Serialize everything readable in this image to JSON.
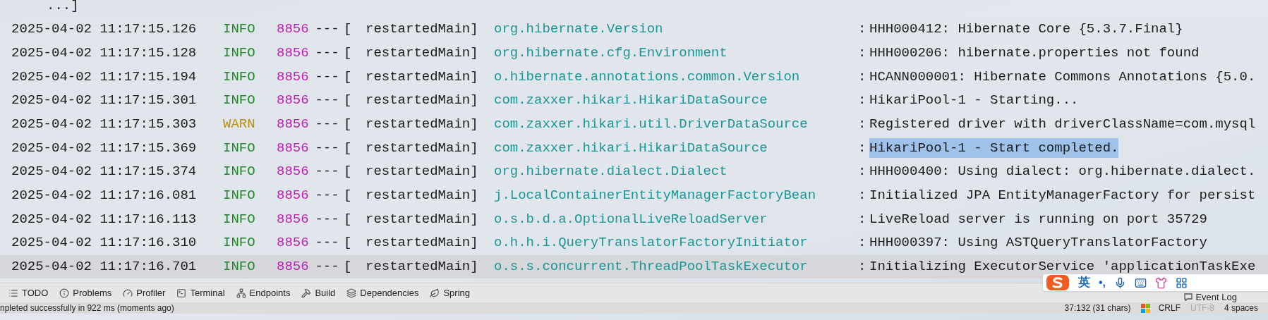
{
  "console": {
    "top_fragment": "...]",
    "rows": [
      {
        "timestamp": "2025-04-02 11:17:15.126",
        "level": "INFO",
        "kind": "info",
        "pid": "8856",
        "separator": "---",
        "bracket": "[",
        "thread": "restartedMain]",
        "logger": "org.hibernate.Version",
        "colon": ":",
        "message": "HHH000412: Hibernate Core {5.3.7.Final}",
        "message_selected": false,
        "current": false
      },
      {
        "timestamp": "2025-04-02 11:17:15.128",
        "level": "INFO",
        "kind": "info",
        "pid": "8856",
        "separator": "---",
        "bracket": "[",
        "thread": "restartedMain]",
        "logger": "org.hibernate.cfg.Environment",
        "colon": ":",
        "message": "HHH000206: hibernate.properties not found",
        "message_selected": false,
        "current": false
      },
      {
        "timestamp": "2025-04-02 11:17:15.194",
        "level": "INFO",
        "kind": "info",
        "pid": "8856",
        "separator": "---",
        "bracket": "[",
        "thread": "restartedMain]",
        "logger": "o.hibernate.annotations.common.Version",
        "colon": ":",
        "message": "HCANN000001: Hibernate Commons Annotations {5.0.",
        "message_selected": false,
        "current": false
      },
      {
        "timestamp": "2025-04-02 11:17:15.301",
        "level": "INFO",
        "kind": "info",
        "pid": "8856",
        "separator": "---",
        "bracket": "[",
        "thread": "restartedMain]",
        "logger": "com.zaxxer.hikari.HikariDataSource",
        "colon": ":",
        "message": "HikariPool-1 - Starting...",
        "message_selected": false,
        "current": false
      },
      {
        "timestamp": "2025-04-02 11:17:15.303",
        "level": "WARN",
        "kind": "warn",
        "pid": "8856",
        "separator": "---",
        "bracket": "[",
        "thread": "restartedMain]",
        "logger": "com.zaxxer.hikari.util.DriverDataSource",
        "colon": ":",
        "message": "Registered driver with driverClassName=com.mysql",
        "message_selected": false,
        "current": false
      },
      {
        "timestamp": "2025-04-02 11:17:15.369",
        "level": "INFO",
        "kind": "info",
        "pid": "8856",
        "separator": "---",
        "bracket": "[",
        "thread": "restartedMain]",
        "logger": "com.zaxxer.hikari.HikariDataSource",
        "colon": ":",
        "message": "HikariPool-1 - Start completed.",
        "message_selected": true,
        "current": false
      },
      {
        "timestamp": "2025-04-02 11:17:15.374",
        "level": "INFO",
        "kind": "info",
        "pid": "8856",
        "separator": "---",
        "bracket": "[",
        "thread": "restartedMain]",
        "logger": "org.hibernate.dialect.Dialect",
        "colon": ":",
        "message": "HHH000400: Using dialect: org.hibernate.dialect.",
        "message_selected": false,
        "current": false
      },
      {
        "timestamp": "2025-04-02 11:17:16.081",
        "level": "INFO",
        "kind": "info",
        "pid": "8856",
        "separator": "---",
        "bracket": "[",
        "thread": "restartedMain]",
        "logger": "j.LocalContainerEntityManagerFactoryBean",
        "colon": ":",
        "message": "Initialized JPA EntityManagerFactory for persist",
        "message_selected": false,
        "current": false
      },
      {
        "timestamp": "2025-04-02 11:17:16.113",
        "level": "INFO",
        "kind": "info",
        "pid": "8856",
        "separator": "---",
        "bracket": "[",
        "thread": "restartedMain]",
        "logger": "o.s.b.d.a.OptionalLiveReloadServer",
        "colon": ":",
        "message": "LiveReload server is running on port 35729",
        "message_selected": false,
        "current": false
      },
      {
        "timestamp": "2025-04-02 11:17:16.310",
        "level": "INFO",
        "kind": "info",
        "pid": "8856",
        "separator": "---",
        "bracket": "[",
        "thread": "restartedMain]",
        "logger": "o.h.h.i.QueryTranslatorFactoryInitiator",
        "colon": ":",
        "message": "HHH000397: Using ASTQueryTranslatorFactory",
        "message_selected": false,
        "current": false
      },
      {
        "timestamp": "2025-04-02 11:17:16.701",
        "level": "INFO",
        "kind": "info",
        "pid": "8856",
        "separator": "---",
        "bracket": "[",
        "thread": "restartedMain]",
        "logger": "o.s.s.concurrent.ThreadPoolTaskExecutor",
        "colon": ":",
        "message": "Initializing ExecutorService 'applicationTaskExe",
        "message_selected": false,
        "current": true
      }
    ]
  },
  "tool_window_bar": {
    "items": [
      {
        "label": "TODO"
      },
      {
        "label": "Problems"
      },
      {
        "label": "Profiler"
      },
      {
        "label": "Terminal"
      },
      {
        "label": "Endpoints"
      },
      {
        "label": "Build"
      },
      {
        "label": "Dependencies"
      },
      {
        "label": "Spring"
      }
    ],
    "event_log": "Event Log"
  },
  "status_bar": {
    "message": "npleted successfully in 922 ms (moments ago)",
    "position": "37:132 (31 chars)",
    "line_separator": "CRLF",
    "encoding": {
      "label": "UTF-8",
      "disabled": true
    },
    "indent": "4 spaces"
  },
  "ime_toolbar": {
    "mode": "英",
    "punctuation": "•,"
  }
}
